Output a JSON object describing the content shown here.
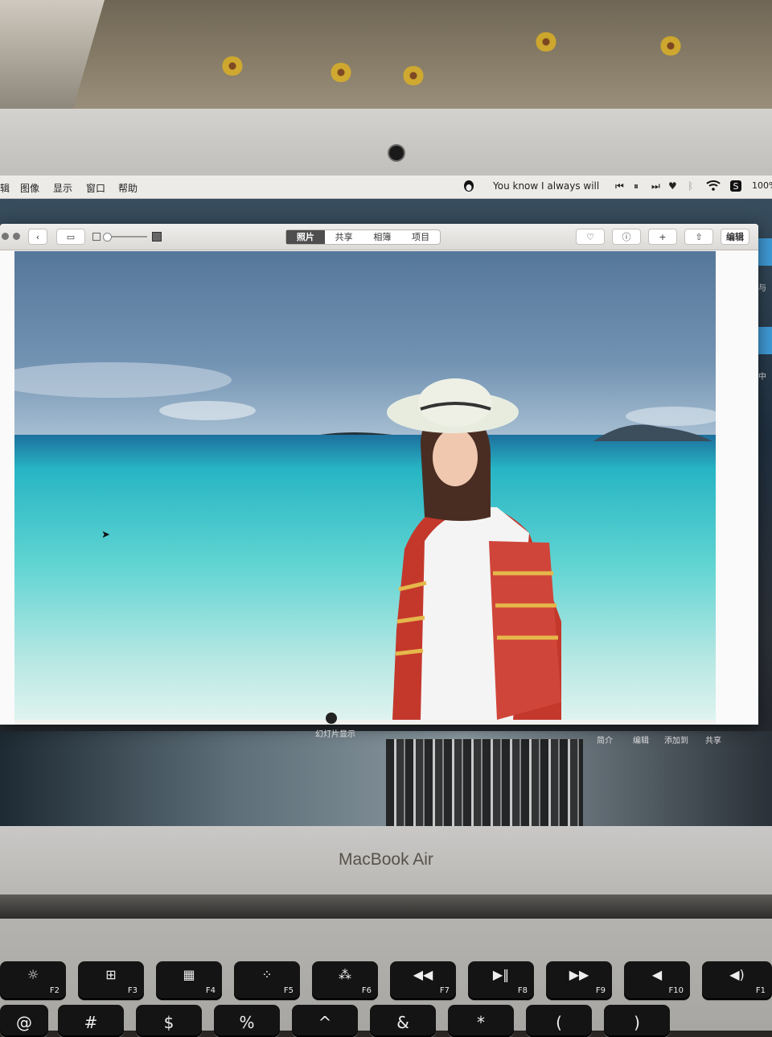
{
  "menubar": {
    "items": [
      "辑",
      "图像",
      "显示",
      "窗口",
      "帮助"
    ],
    "now_playing": "You know I always will",
    "battery": "100%"
  },
  "toolbar": {
    "tabs": [
      {
        "label": "照片",
        "active": true
      },
      {
        "label": "共享",
        "active": false
      },
      {
        "label": "相簿",
        "active": false
      },
      {
        "label": "项目",
        "active": false
      }
    ],
    "edit_label": "编辑"
  },
  "bottombar": {
    "slideshow": "幻灯片显示",
    "info": "简介",
    "edit": "编辑",
    "add_to": "添加到",
    "share": "共享"
  },
  "side_text": [
    "与",
    "中"
  ],
  "laptop": {
    "brand": "MacBook Air"
  },
  "keyboard": {
    "fn_keys": [
      {
        "icon": "☼",
        "label": "F2"
      },
      {
        "icon": "⊞",
        "label": "F3"
      },
      {
        "icon": "▦",
        "label": "F4"
      },
      {
        "icon": "⁘",
        "label": "F5"
      },
      {
        "icon": "⁂",
        "label": "F6"
      },
      {
        "icon": "◀◀",
        "label": "F7"
      },
      {
        "icon": "▶‖",
        "label": "F8"
      },
      {
        "icon": "▶▶",
        "label": "F9"
      },
      {
        "icon": "◀",
        "label": "F10"
      },
      {
        "icon": "◀)",
        "label": "F1"
      }
    ],
    "number_row": [
      "@",
      "#",
      "$",
      "%",
      "^",
      "&",
      "*",
      "(",
      ")"
    ]
  },
  "colors": {
    "sky": "#5d7fa0",
    "sea": "#3ec6c8",
    "toolbar_active": "#4e4e4e"
  }
}
